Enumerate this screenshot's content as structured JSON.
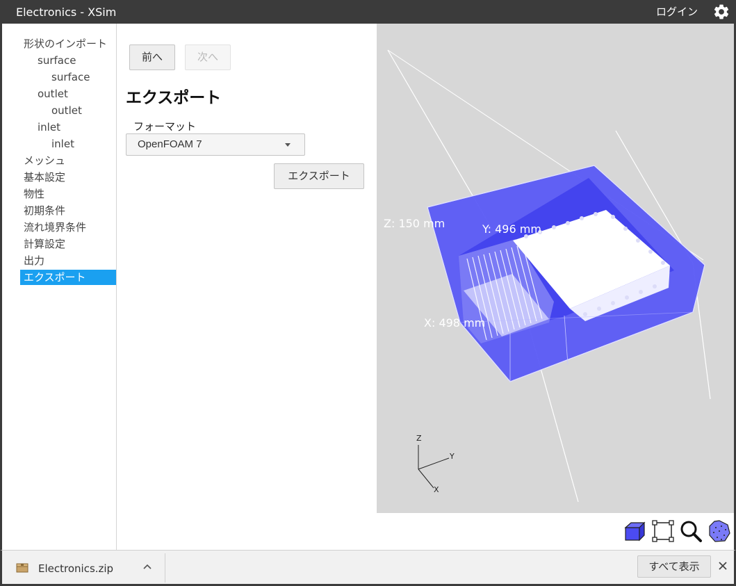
{
  "window": {
    "title": "Electronics - XSim",
    "login_label": "ログイン",
    "settings_icon": "gear-icon"
  },
  "sidebar": {
    "items": [
      {
        "label": "形状のインポート",
        "level": 0
      },
      {
        "label": "surface",
        "level": 1
      },
      {
        "label": "surface",
        "level": 2
      },
      {
        "label": "outlet",
        "level": 1
      },
      {
        "label": "outlet",
        "level": 2
      },
      {
        "label": "inlet",
        "level": 1
      },
      {
        "label": "inlet",
        "level": 2
      },
      {
        "label": "メッシュ",
        "level": 0
      },
      {
        "label": "基本設定",
        "level": 0
      },
      {
        "label": "物性",
        "level": 0
      },
      {
        "label": "初期条件",
        "level": 0
      },
      {
        "label": "流れ境界条件",
        "level": 0
      },
      {
        "label": "計算設定",
        "level": 0
      },
      {
        "label": "出力",
        "level": 0
      },
      {
        "label": "エクスポート",
        "level": 0,
        "selected": true
      }
    ]
  },
  "nav": {
    "prev_label": "前へ",
    "next_label": "次へ"
  },
  "export": {
    "title": "エクスポート",
    "format_label": "フォーマット",
    "format_value": "OpenFOAM 7",
    "export_button": "エクスポート"
  },
  "viewport": {
    "dim_z": "Z: 150 mm",
    "dim_y": "Y: 496 mm",
    "dim_x": "X: 498 mm",
    "axis_z": "Z",
    "axis_y": "Y",
    "axis_x": "X",
    "box_color": "#5555f5",
    "background_color": "#d7d7d7"
  },
  "view_tools": [
    "cube-view-icon",
    "fit-view-icon",
    "zoom-icon",
    "sphere-view-icon"
  ],
  "download_bar": {
    "file_name": "Electronics.zip",
    "show_all_label": "すべて表示"
  }
}
